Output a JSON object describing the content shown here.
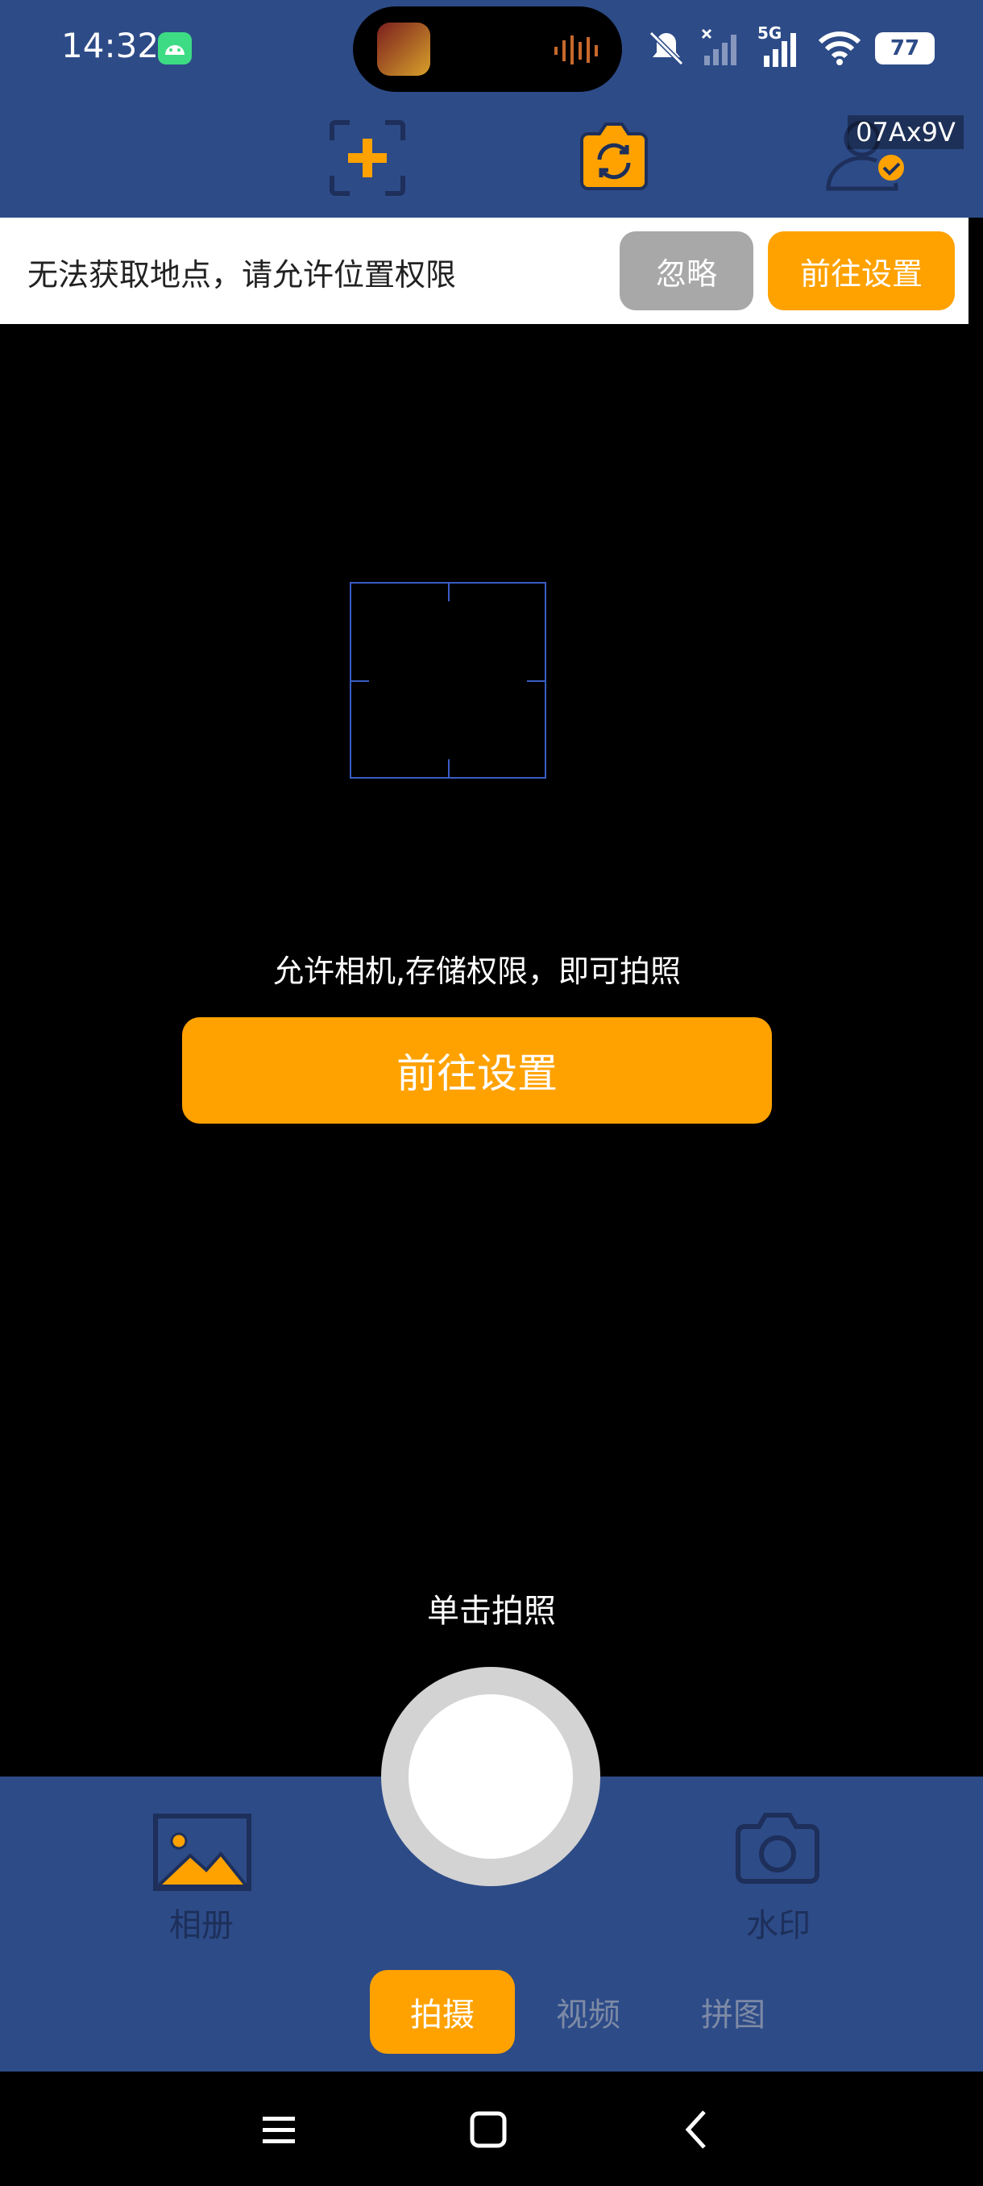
{
  "status_bar": {
    "time": "14:32",
    "battery": "77",
    "network": "5G",
    "icons": [
      "android-notification-icon",
      "mute-icon",
      "no-signal-icon",
      "signal-icon",
      "wifi-icon",
      "battery-icon"
    ]
  },
  "toolbar": {
    "icons": [
      "add-frame-icon",
      "switch-camera-icon",
      "user-check-icon"
    ],
    "tag": "07Ax9V"
  },
  "location_banner": {
    "message": "无法获取地点，请允许位置权限",
    "ignore_label": "忽略",
    "settings_label": "前往设置"
  },
  "camera": {
    "permission_message": "允许相机,存储权限，即可拍照",
    "settings_label": "前往设置",
    "tap_hint": "单击拍照"
  },
  "bottom": {
    "album_label": "相册",
    "watermark_label": "水印",
    "modes": [
      "拍摄",
      "视频",
      "拼图"
    ],
    "active_mode": "拍摄"
  },
  "colors": {
    "primary": "#2d4b87",
    "accent": "#ffa200",
    "gray_button": "#a8a8a8"
  }
}
